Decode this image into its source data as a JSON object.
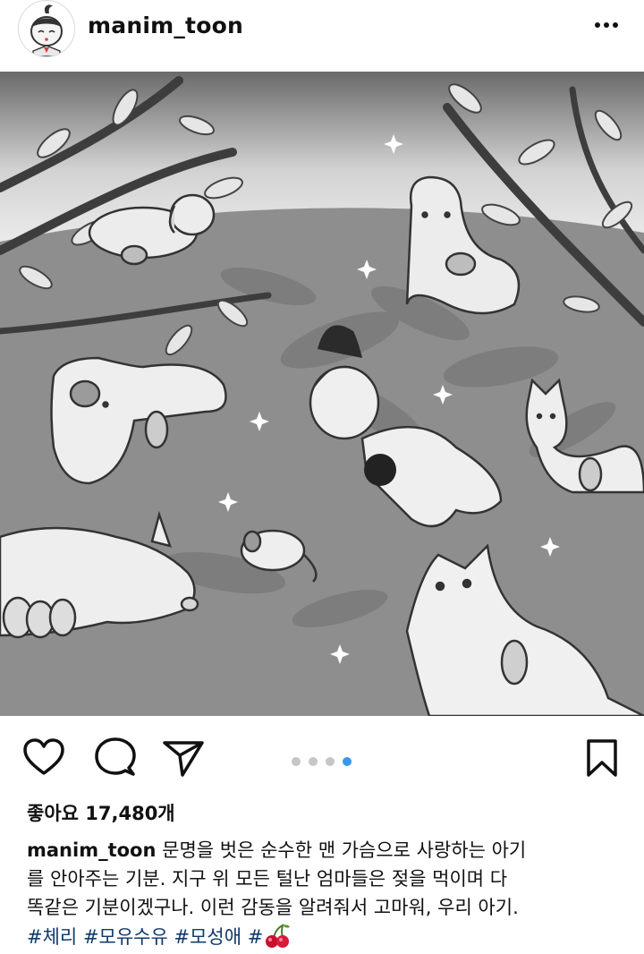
{
  "post": {
    "username": "manim_toon",
    "more_icon": "more-horizontal-icon",
    "likes_text": "좋아요 17,480개",
    "carousel": {
      "count": 4,
      "active_index": 4
    },
    "caption": {
      "username": "manim_toon",
      "line1": "문명을 벗은 순수한 맨 가슴으로 사랑하는 아기",
      "line2": "를 안아주는 기분. 지구 위 모든 털난 엄마들은 젖을 먹이며 다",
      "line3": "똑같은 기분이겠구나. 이런 감동을 알려줘서 고마워, 우리 아기.",
      "hashtags": [
        "#체리",
        "#모유수유",
        "#모성애",
        "#"
      ],
      "emoji": "cherry-emoji"
    }
  },
  "icons": {
    "like": "heart-icon",
    "comment": "comment-icon",
    "share": "send-icon",
    "save": "bookmark-icon"
  },
  "colors": {
    "carousel_active": "#3897f0",
    "carousel_inactive": "#c6c6c6",
    "hashtag": "#0f3a6d"
  }
}
